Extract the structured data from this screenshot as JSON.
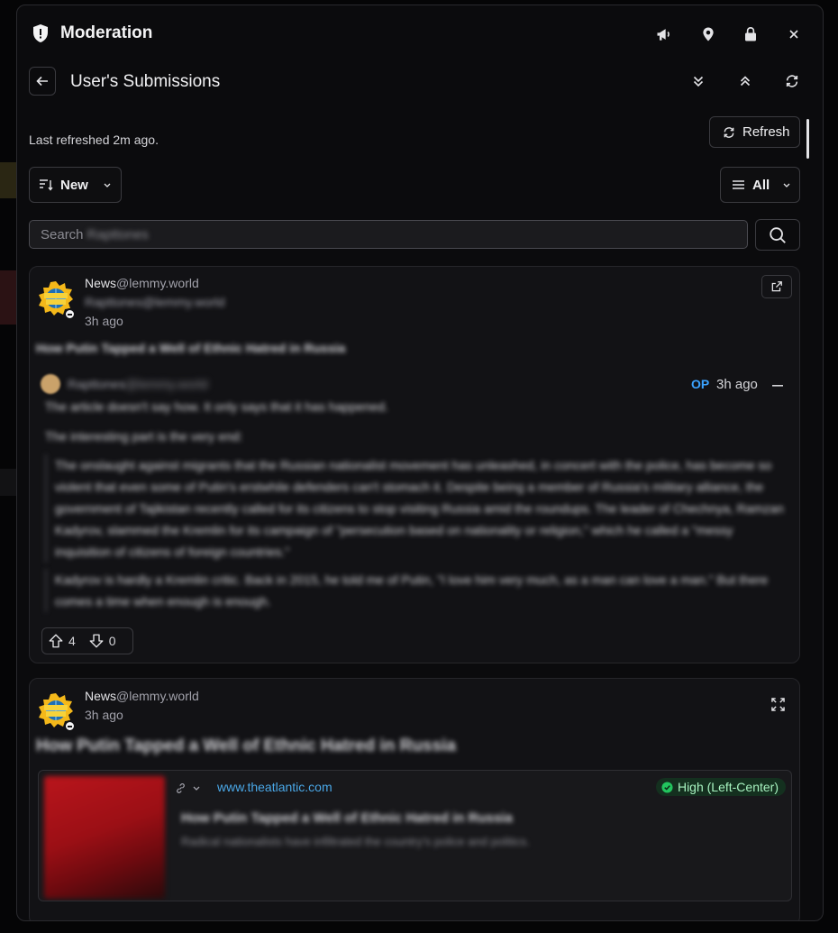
{
  "header": {
    "title": "Moderation",
    "icons": [
      "shield-icon",
      "megaphone-icon",
      "map-pin-icon",
      "lock-icon",
      "close-icon"
    ]
  },
  "subheader": {
    "title": "User's Submissions",
    "icons": [
      "back-arrow-icon",
      "chevrons-down-icon",
      "chevrons-up-icon",
      "refresh-icon"
    ]
  },
  "status": {
    "last_refreshed": "Last refreshed 2m ago.",
    "refresh_label": "Refresh"
  },
  "filters": {
    "sort_label": "New",
    "type_label": "All"
  },
  "search": {
    "placeholder": "Search",
    "redacted_user": "Rapttones"
  },
  "items": [
    {
      "kind": "comment",
      "community": "News",
      "instance": "@lemmy.world",
      "author_redacted": "Rapttones@lemmy.world",
      "time": "3h ago",
      "post_title": "How Putin Tapped a Well of Ethnic Hatred in Russia",
      "comment": {
        "author": "Rapttones",
        "author_instance": "@lemmy.world",
        "op_label": "OP",
        "time": "3h ago",
        "paragraphs": [
          "The article doesn't say how. It only says that it has happened.",
          "The interesting part is the very end:"
        ],
        "quote1": "The onslaught against migrants that the Russian nationalist movement has unleashed, in concert with the police, has become so violent that even some of Putin's erstwhile defenders can't stomach it. Despite being a member of Russia's military alliance, the government of Tajikistan recently called for its citizens to stop visiting Russia amid the roundups. The leader of Chechnya, Ramzan Kadyrov, slammed the Kremlin for its campaign of \"persecution based on nationality or religion,\" which he called a \"messy inquisition of citizens of foreign countries.\"",
        "quote2": "Kadyrov is hardly a Kremlin critic. Back in 2015, he told me of Putin, \"I love him very much, as a man can love a man.\" But there comes a time when enough is enough.",
        "upvotes": "4",
        "downvotes": "0"
      }
    },
    {
      "kind": "post",
      "community": "News",
      "instance": "@lemmy.world",
      "time": "3h ago",
      "post_title": "How Putin Tapped a Well of Ethnic Hatred in Russia",
      "link": {
        "domain": "www.theatlantic.com",
        "bias_label": "High (Left-Center)",
        "title": "How Putin Tapped a Well of Ethnic Hatred in Russia",
        "description": "Radical nationalists have infiltrated the country's police and politics."
      }
    }
  ],
  "colors": {
    "accent": "#3ba3ff",
    "link": "#4aa8e8",
    "badge_green": "#22c55e"
  }
}
